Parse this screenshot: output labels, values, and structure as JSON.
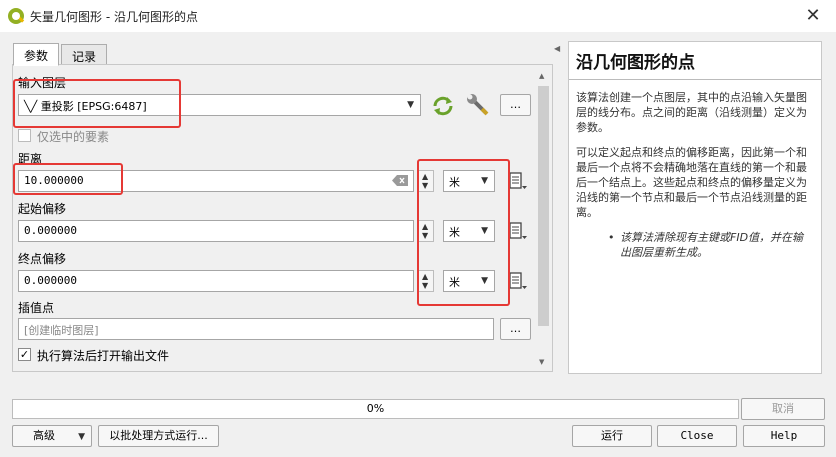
{
  "window": {
    "title": "矢量几何图形 - 沿几何图形的点",
    "close_glyph": "✕"
  },
  "tabs": [
    {
      "label": "参数"
    },
    {
      "label": "记录"
    }
  ],
  "params": {
    "input_layer": {
      "label": "输入图层",
      "value": "╲╱ 重投影 [EPSG:6487]",
      "selected_only_label": "仅选中的要素"
    },
    "distance": {
      "label": "距离",
      "value": "10.000000",
      "unit": "米"
    },
    "start_offset": {
      "label": "起始偏移",
      "value": "0.000000",
      "unit": "米"
    },
    "end_offset": {
      "label": "终点偏移",
      "value": "0.000000",
      "unit": "米"
    },
    "output": {
      "label": "插值点",
      "placeholder": "[创建临时图层]"
    },
    "open_output_label": "执行算法后打开输出文件",
    "ellipsis": "…"
  },
  "help": {
    "title": "沿几何图形的点",
    "p1": "该算法创建一个点图层，其中的点沿输入矢量图层的线分布。点之间的距离（沿线测量）定义为参数。",
    "p2": "可以定义起点和终点的偏移距离，因此第一个和最后一个点将不会精确地落在直线的第一个和最后一个结点上。这些起点和终点的偏移量定义为沿线的第一个节点和最后一个节点沿线测量的距离。",
    "note": "该算法清除现有主键或FID值，并在输出图层重新生成。"
  },
  "progress": {
    "value": 0,
    "text": "0%"
  },
  "buttons": {
    "cancel": "取消",
    "advanced": "高级",
    "batch": "以批处理方式运行...",
    "run": "运行",
    "close": "Close",
    "help": "Help"
  },
  "colors": {
    "highlight": "#e53935",
    "qgis_green": "#93b023"
  }
}
